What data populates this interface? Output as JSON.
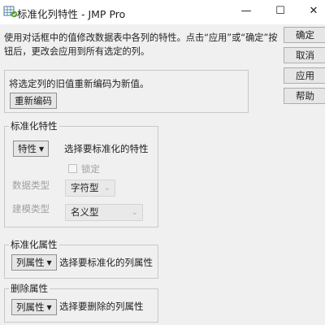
{
  "window": {
    "title": "标准化列特性 - JMP Pro",
    "minimize": "—",
    "maximize": "☐",
    "close": "✕"
  },
  "description": "使用对话框中的值修改数据表中各列的特性。点击“应用”或“确定”按钮后，更改会应用到所有选定的列。",
  "side_buttons": {
    "ok": "确定",
    "cancel": "取消",
    "apply": "应用",
    "help": "帮助"
  },
  "recode": {
    "text": "将选定列的旧值重新编码为新值。",
    "button": "重新编码"
  },
  "standardize_properties": {
    "group_label": "标准化特性",
    "button": "特性",
    "hint": "选择要标准化的特性",
    "lock_label": "锁定",
    "data_type_label": "数据类型",
    "data_type_value": "字符型",
    "modeling_type_label": "建模类型",
    "modeling_type_value": "名义型"
  },
  "standardize_attributes": {
    "group_label": "标准化属性",
    "button": "列属性",
    "hint": "选择要标准化的列属性"
  },
  "delete_attributes": {
    "group_label": "删除属性",
    "button": "列属性",
    "hint": "选择要删除的列属性"
  }
}
